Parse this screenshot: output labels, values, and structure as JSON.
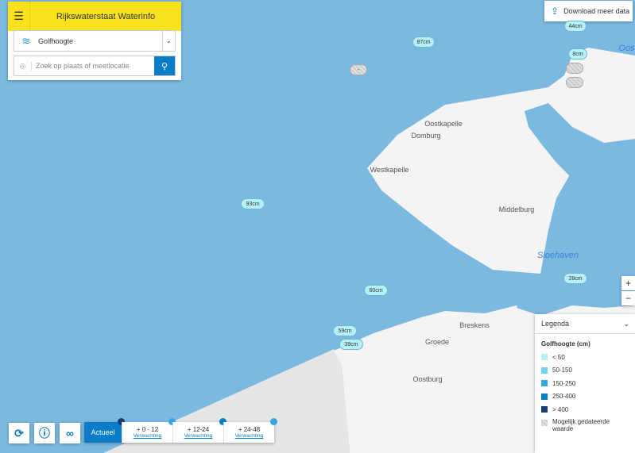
{
  "header": {
    "title": "Rijkswaterstaat Waterinfo",
    "menu_icon": "hamburger-icon"
  },
  "parameter_select": {
    "value": "Golfhoogte",
    "icon": "waves-icon"
  },
  "search": {
    "placeholder": "Zoek op plaats of meetlocatie"
  },
  "download_button": {
    "label": "Download meer data"
  },
  "map": {
    "stations": [
      {
        "label": "87cm",
        "status": "<50"
      },
      {
        "label": "-",
        "status": "dated"
      },
      {
        "label": "93cm",
        "status": "<50"
      },
      {
        "label": "60cm",
        "status": "<50"
      },
      {
        "label": "59cm",
        "status": "<50"
      },
      {
        "label": "39cm",
        "status": "<50"
      },
      {
        "label": "28cm",
        "status": "<50"
      },
      {
        "label": "44cm",
        "status": "<50"
      },
      {
        "label": "8cm",
        "status": "<50"
      }
    ],
    "places": [
      "Domburg",
      "Oostkapelle",
      "Westkapelle",
      "Middelburg",
      "Breskens",
      "Groede",
      "Oostburg"
    ],
    "water_places": [
      "Sloehaven",
      "Oost"
    ]
  },
  "zoom": {
    "in": "+",
    "out": "−"
  },
  "legend": {
    "title": "Legenda",
    "subtitle": "Golfhoogte (cm)",
    "items": [
      {
        "label": "< 50",
        "color": "#b6f0f8"
      },
      {
        "label": "50-150",
        "color": "#6fd3f5"
      },
      {
        "label": "150-250",
        "color": "#36a6e3"
      },
      {
        "label": "250-400",
        "color": "#0b7cc7"
      },
      {
        "label": "> 400",
        "color": "#163e72"
      }
    ],
    "dated_label": "Mogelijk gedateerde waarde"
  },
  "time_tabs": [
    {
      "label": "Actueel",
      "sub": "",
      "dot": "#163e72"
    },
    {
      "label": "+ 0 - 12",
      "sub": "Verwachting",
      "dot": "#36a6e3"
    },
    {
      "label": "+ 12-24",
      "sub": "Verwachting",
      "dot": "#0b7cc7"
    },
    {
      "label": "+ 24-48",
      "sub": "Verwachting",
      "dot": "#36a6e3"
    }
  ]
}
